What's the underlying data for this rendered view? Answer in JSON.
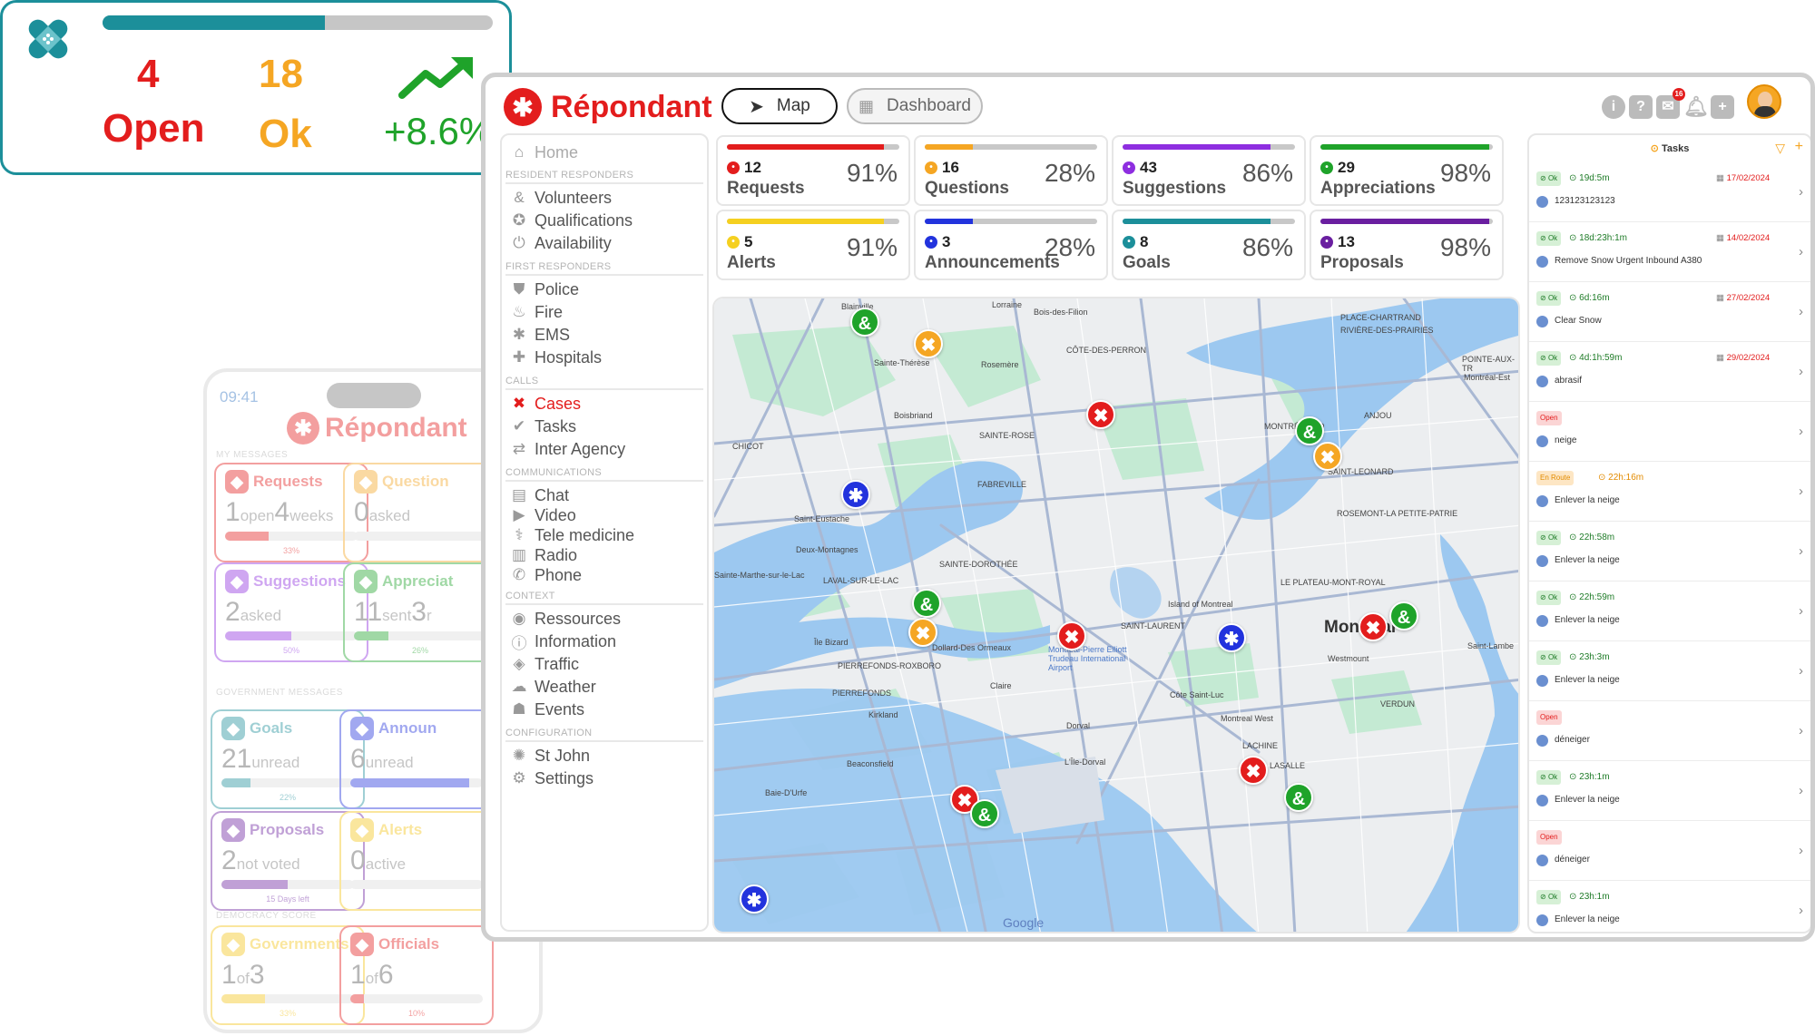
{
  "phone": {
    "time": "09:41",
    "brand": "Répondant",
    "sections": {
      "my_messages": "MY MESSAGES",
      "government_messages": "GOVERNMENT MESSAGES",
      "democracy_score": "DEMOCRACY SCORE"
    },
    "cards": [
      {
        "title": "Requests",
        "big": "1",
        "small": "open",
        "big2": "4",
        "small2": "weeks",
        "pct": "33%",
        "level": 0.33,
        "color": "#e31d1d"
      },
      {
        "title": "Question",
        "big": "0",
        "small": "asked",
        "big2": "",
        "small2": "",
        "pct": "",
        "level": 0,
        "color": "#f5a623"
      },
      {
        "title": "Suggestions",
        "big": "2",
        "small": "asked",
        "big2": "",
        "small2": "",
        "pct": "50%",
        "level": 0.5,
        "color": "#8e2ee0"
      },
      {
        "title": "Appreciat",
        "big": "11",
        "small": "sent",
        "big2": "3",
        "small2": "r",
        "pct": "26%",
        "level": 0.26,
        "color": "#1fa32a"
      },
      {
        "title": "Goals",
        "big": "21",
        "small": "unread",
        "big2": "",
        "small2": "",
        "pct": "22%",
        "level": 0.22,
        "color": "#1c8f9a"
      },
      {
        "title": "Announ",
        "big": "6",
        "small": "unread",
        "big2": "",
        "small2": "",
        "pct": "",
        "level": 0.9,
        "color": "#2233dd"
      },
      {
        "title": "Proposals",
        "big": "2",
        "small": "not voted",
        "big2": "",
        "small2": "",
        "pct": "15 Days left",
        "level": 0.5,
        "color": "#6a1fa0"
      },
      {
        "title": "Alerts",
        "big": "0",
        "small": "active",
        "big2": "",
        "small2": "",
        "pct": "",
        "level": 0,
        "color": "#f5c518"
      },
      {
        "title": "Governments",
        "big": "1",
        "small": "of",
        "big2": "3",
        "small2": "",
        "pct": "33%",
        "level": 0.33,
        "color": "#f5c518"
      },
      {
        "title": "Officials",
        "big": "1",
        "small": "of",
        "big2": "6",
        "small2": "",
        "pct": "10%",
        "level": 0.1,
        "color": "#e31d1d"
      }
    ]
  },
  "float_card": {
    "progress": 0.57,
    "open_count": "4",
    "open_label": "Open",
    "ok_count": "18",
    "ok_label": "Ok",
    "trend": "+8.6%",
    "colors": {
      "open": "#e31d1d",
      "ok": "#f5a623",
      "trend": "#1fa32a",
      "accent": "#1c8f9a"
    }
  },
  "app": {
    "brand": "Répondant",
    "view_tabs": [
      {
        "label": "Map",
        "active": true
      },
      {
        "label": "Dashboard",
        "active": false
      }
    ],
    "notification_count": "16",
    "sidebar": {
      "home": "Home",
      "sections": [
        {
          "title": "RESIDENT RESPONDERS",
          "items": [
            {
              "label": "Volunteers",
              "icon": "ampersand-icon"
            },
            {
              "label": "Qualifications",
              "icon": "award-icon"
            },
            {
              "label": "Availability",
              "icon": "power-icon"
            }
          ]
        },
        {
          "title": "FIRST RESPONDERS",
          "items": [
            {
              "label": "Police",
              "icon": "shield-icon"
            },
            {
              "label": "Fire",
              "icon": "flame-icon"
            },
            {
              "label": "EMS",
              "icon": "star-of-life-icon"
            },
            {
              "label": "Hospitals",
              "icon": "cross-icon"
            }
          ]
        },
        {
          "title": "CALLS",
          "items": [
            {
              "label": "Cases",
              "icon": "bandage-icon",
              "active": true
            },
            {
              "label": "Tasks",
              "icon": "check-circle-icon"
            },
            {
              "label": "Inter Agency",
              "icon": "arrows-icon"
            }
          ]
        },
        {
          "title": "COMMUNICATIONS",
          "items": [
            {
              "label": "Chat",
              "icon": "chat-icon"
            },
            {
              "label": "Video",
              "icon": "video-icon"
            },
            {
              "label": "Tele medicine",
              "icon": "stethoscope-icon"
            },
            {
              "label": "Radio",
              "icon": "radio-icon"
            },
            {
              "label": "Phone",
              "icon": "phone-icon"
            }
          ]
        },
        {
          "title": "CONTEXT",
          "items": [
            {
              "label": "Ressources",
              "icon": "resources-icon"
            },
            {
              "label": "Information",
              "icon": "info-icon"
            },
            {
              "label": "Traffic",
              "icon": "traffic-icon"
            },
            {
              "label": "Weather",
              "icon": "weather-icon"
            },
            {
              "label": "Events",
              "icon": "events-icon"
            }
          ]
        },
        {
          "title": "CONFIGURATION",
          "items": [
            {
              "label": "St John",
              "icon": "st-john-icon"
            },
            {
              "label": "Settings",
              "icon": "gear-icon"
            }
          ]
        }
      ]
    },
    "stats": [
      {
        "count": "12",
        "label": "Requests",
        "pct": "91%",
        "level": 0.91,
        "color": "#e31d1d"
      },
      {
        "count": "16",
        "label": "Questions",
        "pct": "28%",
        "level": 0.28,
        "color": "#f5a623"
      },
      {
        "count": "43",
        "label": "Suggestions",
        "pct": "86%",
        "level": 0.86,
        "color": "#8e2ee0"
      },
      {
        "count": "29",
        "label": "Appreciations",
        "pct": "98%",
        "level": 0.98,
        "color": "#1fa32a"
      },
      {
        "count": "5",
        "label": "Alerts",
        "pct": "91%",
        "level": 0.91,
        "color": "#f5d020"
      },
      {
        "count": "3",
        "label": "Announcements",
        "pct": "28%",
        "level": 0.28,
        "color": "#2233dd"
      },
      {
        "count": "8",
        "label": "Goals",
        "pct": "86%",
        "level": 0.86,
        "color": "#1c8f9a"
      },
      {
        "count": "13",
        "label": "Proposals",
        "pct": "98%",
        "level": 0.98,
        "color": "#6a1fa0"
      }
    ],
    "map": {
      "labels": [
        "Blainville",
        "Lorraine",
        "Bois-des-Filion",
        "PLACE-CHARTRAND",
        "RIVIÈRE-DES-PRAIRIES",
        "Sainte-Thérèse",
        "Rosemère",
        "CÔTE-DES-PERRON",
        "POINTE-AUX-TR",
        "Montréal-Est",
        "Boisbriand",
        "MONTRÉAL-NO",
        "ANJOU",
        "SAINTE-ROSE",
        "CHICOT",
        "SAINT-LEONARD",
        "FABREVILLE",
        "ROSEMONT-LA PETITE-PATRIE",
        "Saint-Eustache",
        "Deux-Montagnes",
        "SAINTE-DOROTHÉE",
        "Sainte-Marthe-sur-le-Lac",
        "LAVAL-SUR-LE-LAC",
        "LE PLATEAU-MONT-ROYAL",
        "Island of Montreal",
        "SAINT-LAURENT",
        "Montreal",
        "Île Bizard",
        "Dollard-Des Ormeaux",
        "Westmount",
        "Saint-Lambe",
        "PIERREFONDS-ROXBORO",
        "Montréal-Pierre Elliott Trudeau International Airport",
        "PIERREFONDS",
        "Claire",
        "Côte Saint-Luc",
        "VERDUN",
        "Kirkland",
        "Dorval",
        "Montreal West",
        "LACHINE",
        "Beaconsfield",
        "L'Île-Dorval",
        "LASALLE",
        "Baie-D'Urfe",
        "Google"
      ]
    },
    "tasks": {
      "title": "Tasks",
      "rows": [
        {
          "status": "Ok",
          "time": "19d:5m",
          "date": "17/02/2024",
          "name": "123123123123"
        },
        {
          "status": "Ok",
          "time": "18d:23h:1m",
          "date": "14/02/2024",
          "name": "Remove Snow Urgent Inbound A380"
        },
        {
          "status": "Ok",
          "time": "6d:16m",
          "date": "27/02/2024",
          "name": "Clear Snow"
        },
        {
          "status": "Ok",
          "time": "4d:1h:59m",
          "date": "29/02/2024",
          "name": "abrasif"
        },
        {
          "status": "Open",
          "time": "",
          "date": "",
          "name": "neige"
        },
        {
          "status": "En Route",
          "time": "22h:16m",
          "date": "",
          "name": "Enlever la neige"
        },
        {
          "status": "Ok",
          "time": "22h:58m",
          "date": "",
          "name": "Enlever la neige"
        },
        {
          "status": "Ok",
          "time": "22h:59m",
          "date": "",
          "name": "Enlever la neige"
        },
        {
          "status": "Ok",
          "time": "23h:3m",
          "date": "",
          "name": "Enlever la neige"
        },
        {
          "status": "Open",
          "time": "",
          "date": "",
          "name": "déneiger"
        },
        {
          "status": "Ok",
          "time": "23h:1m",
          "date": "",
          "name": "Enlever la neige"
        },
        {
          "status": "Open",
          "time": "",
          "date": "",
          "name": "déneiger"
        },
        {
          "status": "Ok",
          "time": "23h:1m",
          "date": "",
          "name": "Enlever la neige"
        }
      ]
    }
  }
}
